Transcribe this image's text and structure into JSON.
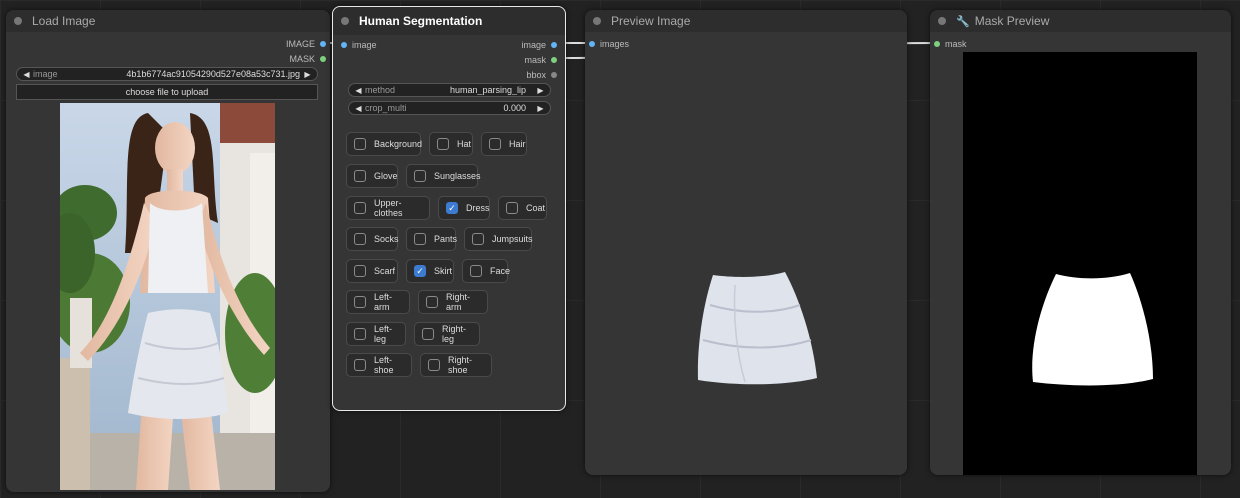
{
  "load_image": {
    "title": "Load Image",
    "outputs": [
      "IMAGE",
      "MASK"
    ],
    "image_widget": {
      "label": "image",
      "value": "4b1b6774ac91054290d527e08a53c731.jpg"
    },
    "upload_label": "choose file to upload"
  },
  "human_seg": {
    "title": "Human Segmentation",
    "input_label": "image",
    "outputs": [
      "image",
      "mask",
      "bbox"
    ],
    "method": {
      "label": "method",
      "value": "human_parsing_lip"
    },
    "crop_multi": {
      "label": "crop_multi",
      "value": "0.000"
    },
    "checkboxes": [
      {
        "label": "Background",
        "checked": false
      },
      {
        "label": "Hat",
        "checked": false
      },
      {
        "label": "Hair",
        "checked": false
      },
      {
        "label": "Glove",
        "checked": false
      },
      {
        "label": "Sunglasses",
        "checked": false
      },
      {
        "label": "Upper-clothes",
        "checked": false
      },
      {
        "label": "Dress",
        "checked": true
      },
      {
        "label": "Coat",
        "checked": false
      },
      {
        "label": "Socks",
        "checked": false
      },
      {
        "label": "Pants",
        "checked": false
      },
      {
        "label": "Jumpsuits",
        "checked": false
      },
      {
        "label": "Scarf",
        "checked": false
      },
      {
        "label": "Skirt",
        "checked": true
      },
      {
        "label": "Face",
        "checked": false
      },
      {
        "label": "Left-arm",
        "checked": false
      },
      {
        "label": "Right-arm",
        "checked": false
      },
      {
        "label": "Left-leg",
        "checked": false
      },
      {
        "label": "Right-leg",
        "checked": false
      },
      {
        "label": "Left-shoe",
        "checked": false
      },
      {
        "label": "Right-shoe",
        "checked": false
      }
    ]
  },
  "preview": {
    "title": "Preview Image",
    "input_label": "images"
  },
  "mask_preview": {
    "title": "Mask Preview",
    "input_label": "mask",
    "icon": "wrench-icon"
  },
  "colors": {
    "image_slot": "#64b5f6",
    "mask_slot": "#7ed07e",
    "checkbox_on": "#3d7bd1"
  }
}
